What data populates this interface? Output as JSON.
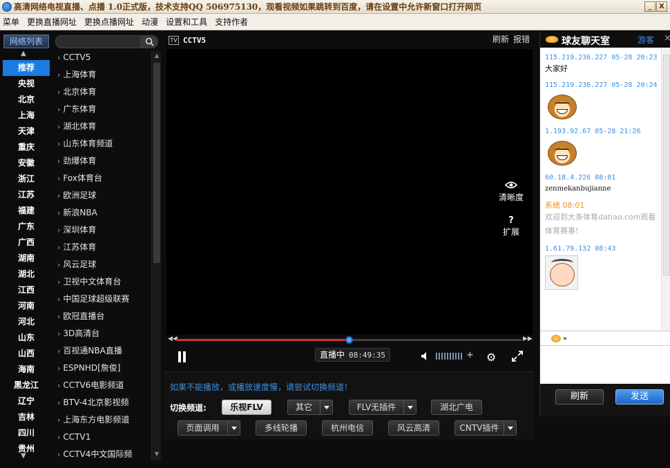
{
  "window": {
    "title": "高清网络电视直播、点播 1.0正式版，技术支持QQ 506975130，观看视频如果跳转到百度，请在设置中允许新窗口打开网页",
    "min": "_",
    "close": "X"
  },
  "menu": [
    "菜单",
    "更换直播网址",
    "更换点播网址",
    "动漫",
    "设置和工具",
    "支持作者"
  ],
  "left_nav": {
    "tab": "网络列表",
    "provinces": [
      "推荐",
      "央视",
      "北京",
      "上海",
      "天津",
      "重庆",
      "安徽",
      "浙江",
      "江苏",
      "福建",
      "广东",
      "广西",
      "湖南",
      "湖北",
      "江西",
      "河南",
      "河北",
      "山东",
      "山西",
      "海南",
      "黑龙江",
      "辽宁",
      "吉林",
      "四川",
      "贵州"
    ],
    "active_index": 0
  },
  "channels": [
    "CCTV5",
    "上海体育",
    "北京体育",
    "广东体育",
    "湖北体育",
    "山东体育频道",
    "劲爆体育",
    "Fox体育台",
    "欧洲足球",
    "新浪NBA",
    "深圳体育",
    "江苏体育",
    "风云足球",
    "卫视中文体育台",
    "中国足球超级联赛",
    "欧冠直播台",
    "3D高清台",
    "百视通NBA直播",
    "ESPNHD[詹俊]",
    "CCTV6电影频道",
    "BTV-4北京影视频",
    "上海东方电影频道",
    "CCTV1",
    "CCTV4中文国际频"
  ],
  "player": {
    "tv_icon": "TV",
    "channel_name": "CCTV5",
    "refresh": "刷新",
    "report": "报错",
    "clarity": "清晰度",
    "expand_icon": "?",
    "expand": "扩展",
    "progress_fraction": 0.5,
    "live_label": "直播中",
    "time": "08:49:35",
    "volume_plus": "+"
  },
  "switch_panel": {
    "notice": "如果不能播放，或播放速度慢，请尝试切换频道！",
    "label": "切换频道:",
    "buttons_row1": [
      "乐视FLV",
      "其它",
      "FLV无插件",
      "湖北广电"
    ],
    "buttons_row2": [
      "页面调用",
      "多线轮播",
      "杭州电信",
      "风云高清",
      "CNTV插件"
    ]
  },
  "chat": {
    "title": "球友聊天室",
    "guest": "游客",
    "close": "×",
    "messages": [
      {
        "meta": "115.219.236.227  05-28 20:23",
        "text": "大家好"
      },
      {
        "meta": "115.219.236.227  05-28 20:24",
        "sticker": "monkey-sticker"
      },
      {
        "meta": "1.193.92.67  05-28 21:26",
        "sticker": "monkey-sticker"
      },
      {
        "meta": "60.18.4.226  08:01",
        "text": "zenmekanbujianne"
      },
      {
        "meta": "系统  08:01",
        "text": "欢迎到大条体育datiao.com观看体育赛事!",
        "system": true
      },
      {
        "meta": "1.61.79.132  08:43",
        "sticker": "baby-sticker"
      }
    ],
    "refresh_btn": "刷新",
    "send_btn": "发送"
  }
}
